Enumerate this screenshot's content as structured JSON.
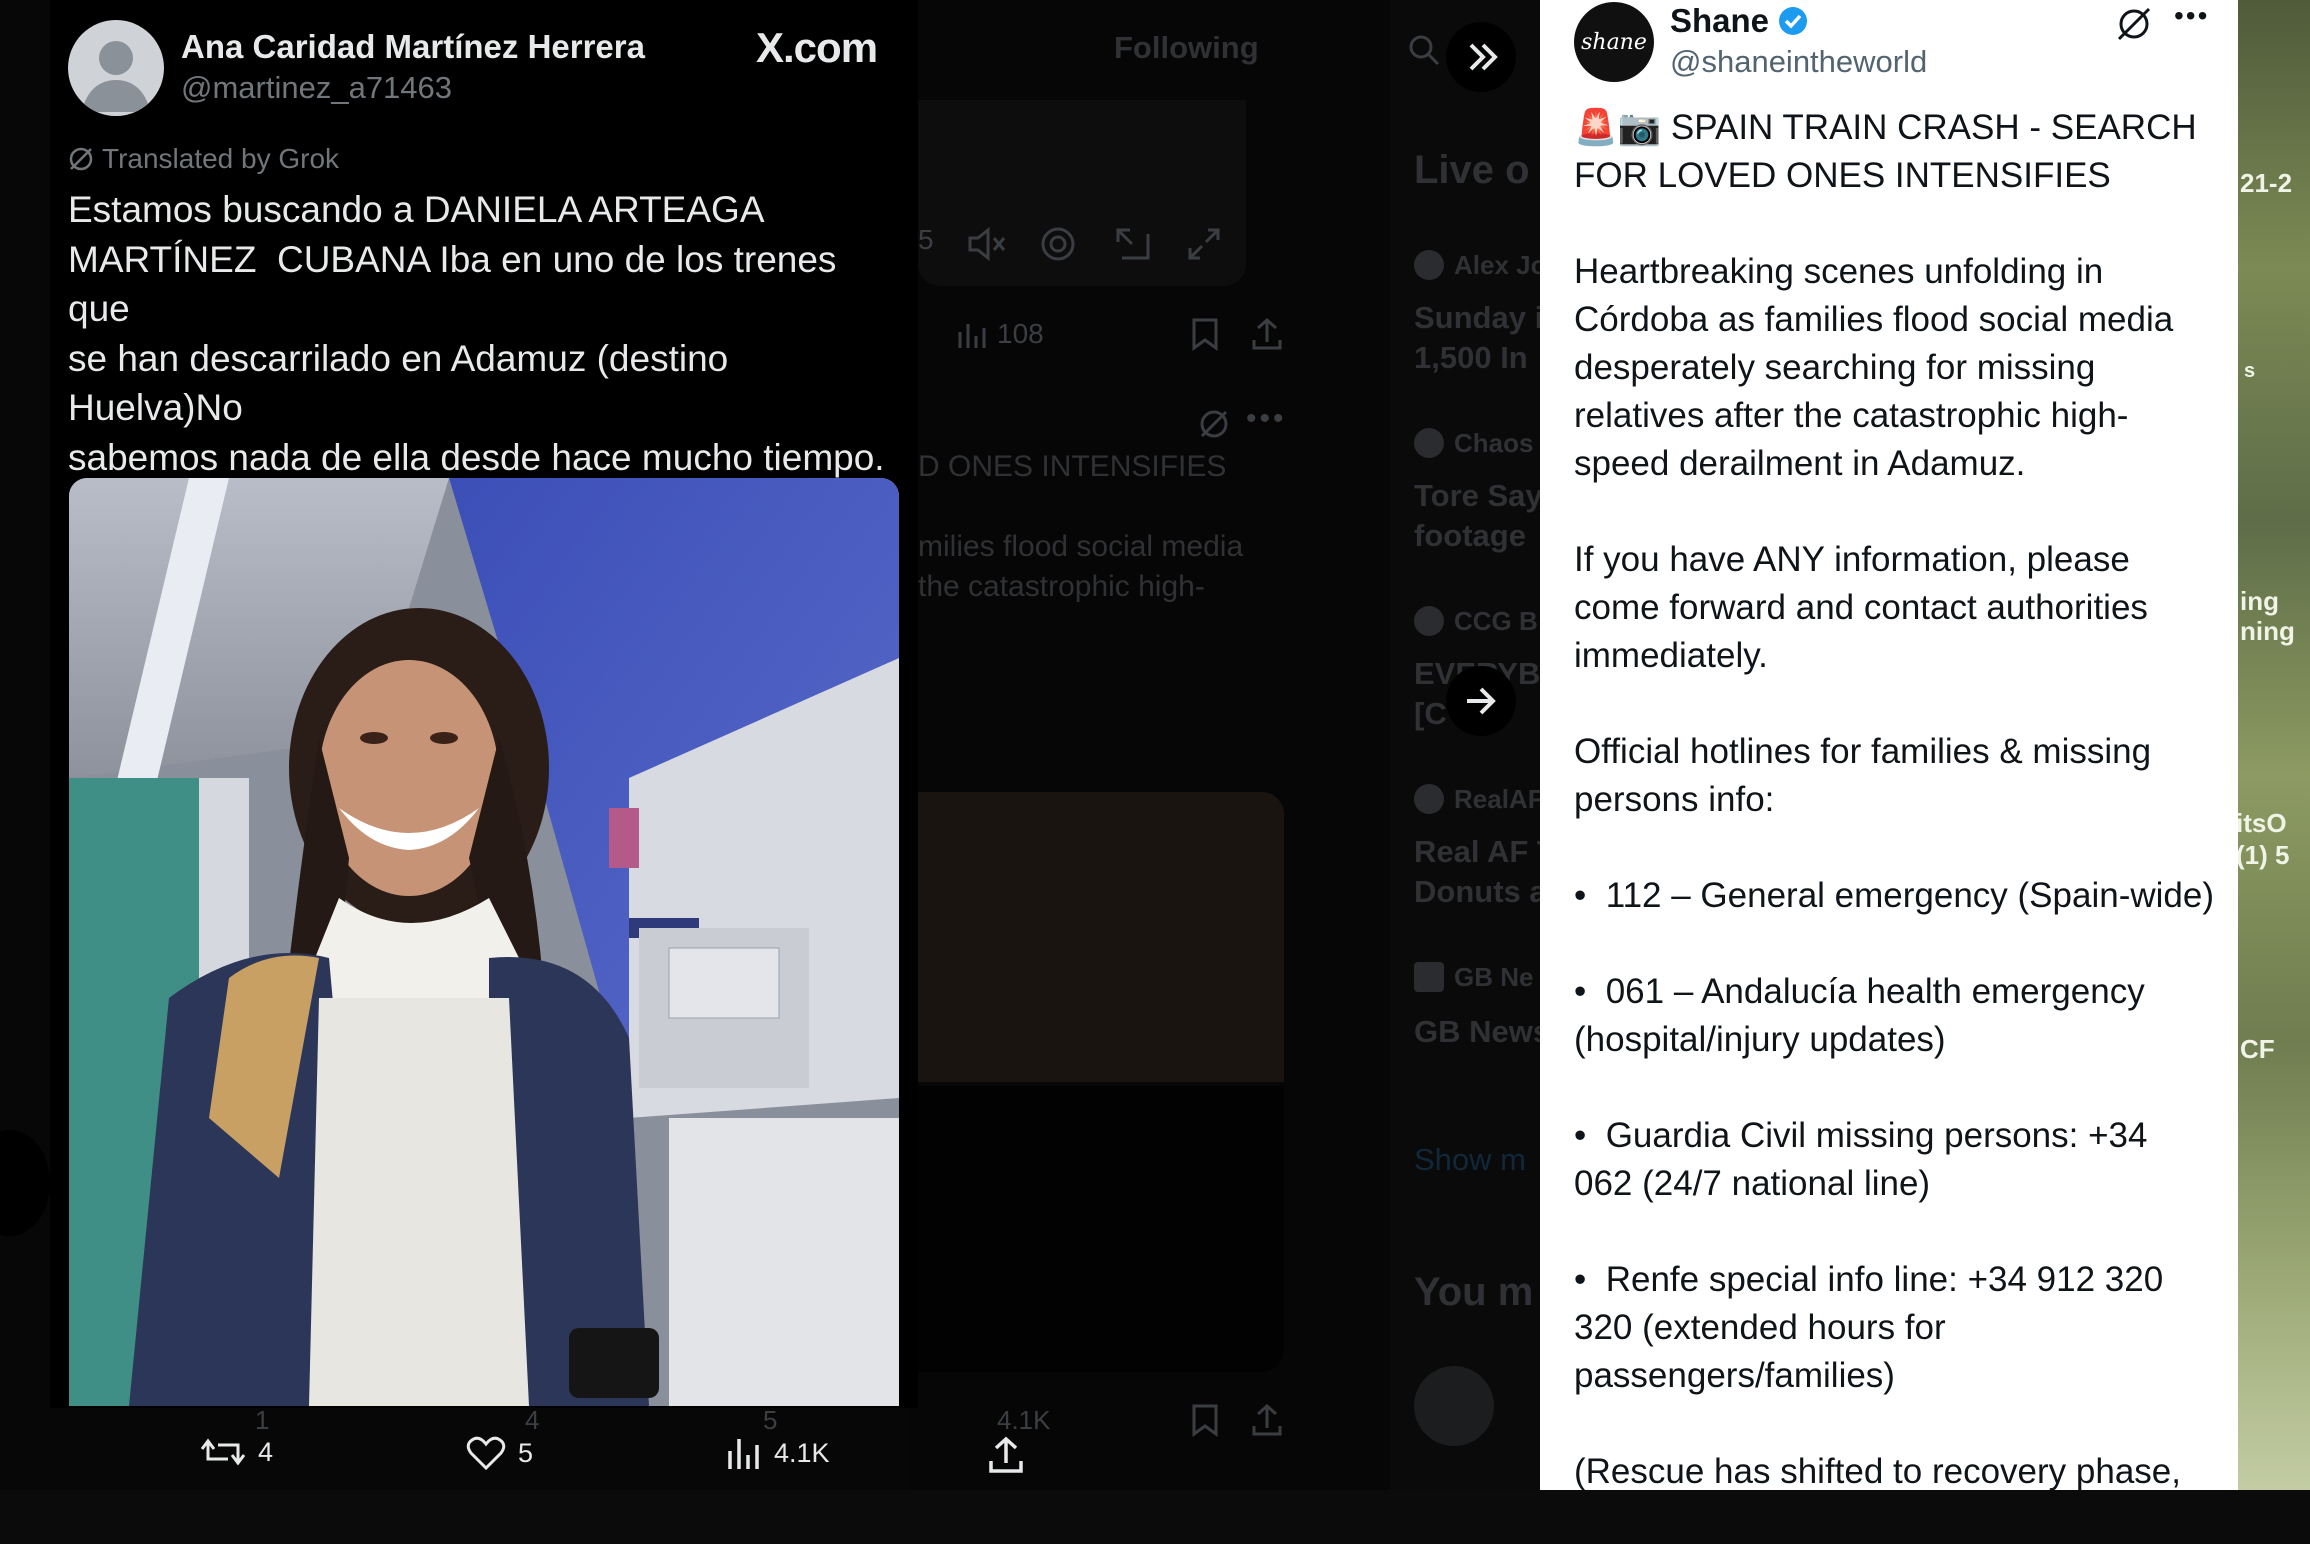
{
  "left_post": {
    "author_name": "Ana Caridad Martínez Herrera",
    "author_handle": "@martinez_a71463",
    "site_label": "X.com",
    "translated_label": "Translated by Grok",
    "body": "Estamos buscando a DANIELA ARTEAGA\nMARTÍNEZ  CUBANA Iba en uno de los trenes que\nse han descarrilado en Adamuz (destino Huelva)No\nsabemos nada de ella desde hace mucho tiempo.\nPor favor, difusión y cualquier noticia contacten.",
    "actions": {
      "reposts": "4",
      "likes": "5",
      "views": "4.1K"
    }
  },
  "right_post": {
    "author_name": "Shane",
    "author_handle": "@shaneintheworld",
    "avatar_text": "shane",
    "title": "🚨📷 SPAIN TRAIN CRASH - SEARCH FOR LOVED ONES INTENSIFIES",
    "paragraph1": "Heartbreaking scenes unfolding in Córdoba as families flood social media desperately searching for missing relatives after the catastrophic high-speed derailment in Adamuz.",
    "paragraph2": "If you have ANY information, please come forward and contact authorities immediately.",
    "paragraph3": "Official hotlines for families & missing persons info:",
    "hotlines": [
      "112 – General emergency (Spain-wide)",
      "061 – Andalucía health emergency (hospital/injury updates)",
      "Guardia Civil missing persons: +34 062 (24/7 national line)",
      "Renfe special info line: +34 912 320 320 (extended hours for passengers/families)"
    ],
    "paragraph_last": "(Rescue has shifted to recovery phase,"
  },
  "background": {
    "following_tab": "Following",
    "video_time": "5",
    "views_top": "108",
    "headline_fragment": "D ONES INTENSIFIES",
    "text_fragment_1": "milies flood social media",
    "text_fragment_2": "the catastrophic high-",
    "live_title": "Live o",
    "live_items": [
      {
        "name": "Alex Jo",
        "text": "Sunday i\n1,500 In"
      },
      {
        "name": "Chaos",
        "text": "Tore Say\nfootage"
      },
      {
        "name": "CCG B",
        "text": "EVERYBO\n[C    N"
      },
      {
        "name": "RealAF",
        "text": "Real AF T\nDonuts a"
      },
      {
        "name": "GB Ne",
        "text": "GB News"
      }
    ],
    "show_more": "Show m",
    "you_might": "You m",
    "bottom_counts": {
      "c1": "1",
      "c2": "4",
      "c3": "5",
      "c4": "4.1K"
    },
    "green_texts": [
      "21-2",
      "s",
      "ing",
      "ning",
      "itsO",
      "(1) 5",
      "CF"
    ]
  }
}
